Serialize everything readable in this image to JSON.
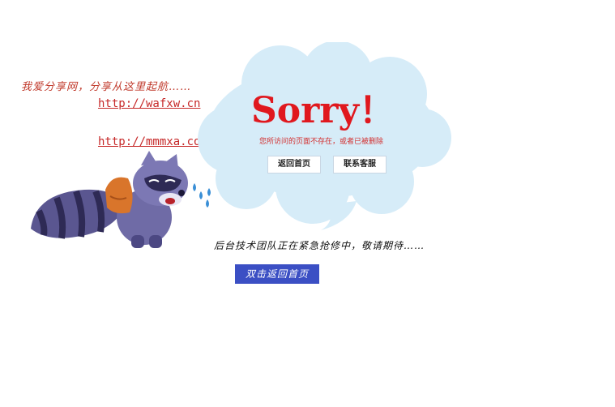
{
  "tagline": "我爱分享网，分享从这里起航……",
  "links": [
    "http://wafxw.cn",
    "http://mmmxa.com"
  ],
  "error": {
    "title": "Sorry！",
    "message": "您所访问的页面不存在，或者已被删除",
    "home_button": "返回首页",
    "service_button": "联系客服"
  },
  "maintenance_text": "后台技术团队正在紧急抢修中，敬请期待……",
  "dblclick_button": "双击返回首页",
  "colors": {
    "accent_red": "#e0181e",
    "cloud": "#d6ecf8",
    "button_blue": "#3b4fc4"
  },
  "icons": {
    "mascot": "crying-raccoon-illustration",
    "bubble": "cloud-speech-bubble"
  }
}
